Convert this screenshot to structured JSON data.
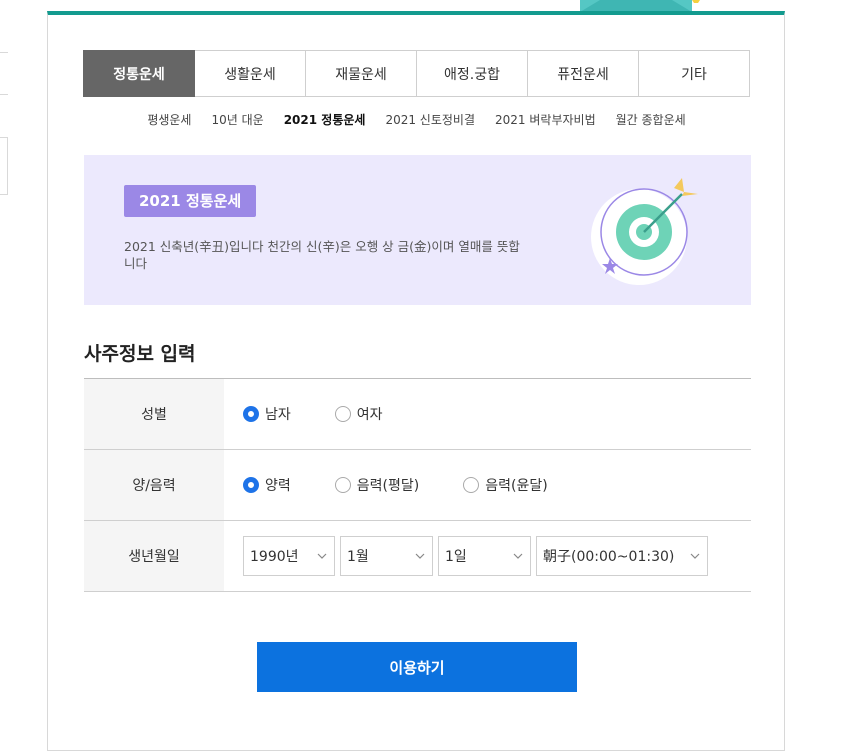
{
  "tabs": [
    {
      "label": "정통운세",
      "active": true
    },
    {
      "label": "생활운세",
      "active": false
    },
    {
      "label": "재물운세",
      "active": false
    },
    {
      "label": "애정.궁합",
      "active": false
    },
    {
      "label": "퓨전운세",
      "active": false
    },
    {
      "label": "기타",
      "active": false
    }
  ],
  "subnav": [
    {
      "label": "평생운세"
    },
    {
      "label": "10년 대운"
    },
    {
      "label": "2021 정통운세"
    },
    {
      "label": "2021 신토정비결"
    },
    {
      "label": "2021 벼락부자비법"
    },
    {
      "label": "월간 종합운세"
    }
  ],
  "banner": {
    "badge": "2021 정통운세",
    "description": "2021 신축년(辛丑)입니다 천간의 신(辛)은 오행 상 금(金)이며 열매를 뜻합니다",
    "icon": "target-icon"
  },
  "form": {
    "title": "사주정보 입력",
    "gender": {
      "label": "성별",
      "options": [
        "남자",
        "여자"
      ],
      "selected": "남자"
    },
    "calendar": {
      "label": "양/음력",
      "options": [
        "양력",
        "음력(평달)",
        "음력(윤달)"
      ],
      "selected": "양력"
    },
    "birth": {
      "label": "생년월일",
      "year": "1990년",
      "month": "1월",
      "day": "1일",
      "time": "朝子(00:00~01:30)"
    }
  },
  "submit_label": "이용하기",
  "colors": {
    "accent": "#0c72df",
    "banner_bg": "#ece9fd",
    "badge": "#9b88e6",
    "top_border": "#139b8f",
    "active_tab": "#666666"
  }
}
